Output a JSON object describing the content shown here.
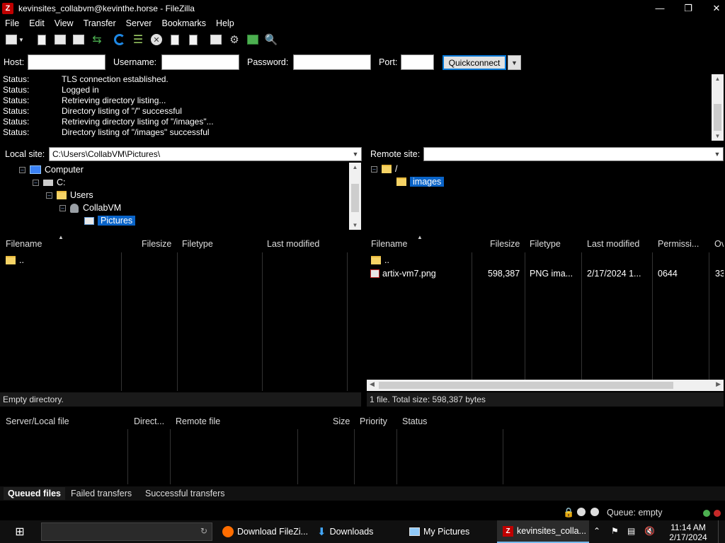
{
  "window": {
    "title": "kevinsites_collabvm@kevinthe.horse - FileZilla",
    "app_icon_letter": "Z"
  },
  "menu": [
    "File",
    "Edit",
    "View",
    "Transfer",
    "Server",
    "Bookmarks",
    "Help"
  ],
  "quickconnect": {
    "host_label": "Host:",
    "username_label": "Username:",
    "password_label": "Password:",
    "port_label": "Port:",
    "host_value": "",
    "username_value": "",
    "password_value": "",
    "port_value": "",
    "button_label": "Quickconnect"
  },
  "log": [
    {
      "k": "Status:",
      "v": "TLS connection established."
    },
    {
      "k": "Status:",
      "v": "Logged in"
    },
    {
      "k": "Status:",
      "v": "Retrieving directory listing..."
    },
    {
      "k": "Status:",
      "v": "Directory listing of \"/\" successful"
    },
    {
      "k": "Status:",
      "v": "Retrieving directory listing of \"/images\"..."
    },
    {
      "k": "Status:",
      "v": "Directory listing of \"/images\" successful"
    }
  ],
  "local": {
    "site_label": "Local site:",
    "path": "C:\\Users\\CollabVM\\Pictures\\",
    "tree": [
      "Computer",
      "C:",
      "Users",
      "CollabVM",
      "Pictures"
    ],
    "cols": {
      "filename": "Filename",
      "filesize": "Filesize",
      "filetype": "Filetype",
      "modified": "Last modified"
    },
    "parent": "..",
    "status": "Empty directory."
  },
  "remote": {
    "site_label": "Remote site:",
    "path": "",
    "tree": [
      "/",
      "images"
    ],
    "cols": {
      "filename": "Filename",
      "filesize": "Filesize",
      "filetype": "Filetype",
      "modified": "Last modified",
      "perms": "Permissi...",
      "owner": "Ov"
    },
    "parent": "..",
    "file": {
      "name": "artix-vm7.png",
      "size": "598,387",
      "type": "PNG ima...",
      "modified": "2/17/2024 1...",
      "perms": "0644",
      "owner": "33"
    },
    "status": "1 file. Total size: 598,387 bytes"
  },
  "queue": {
    "cols": {
      "file": "Server/Local file",
      "dir": "Direct...",
      "remote": "Remote file",
      "size": "Size",
      "priority": "Priority",
      "status": "Status"
    },
    "tabs": [
      "Queued files",
      "Failed transfers",
      "Successful transfers"
    ],
    "state": "Queue: empty"
  },
  "taskbar": {
    "tasks": [
      "Download FileZi...",
      "Downloads",
      "My Pictures",
      "kevinsites_colla..."
    ],
    "time": "11:14 AM",
    "date": "2/17/2024"
  }
}
